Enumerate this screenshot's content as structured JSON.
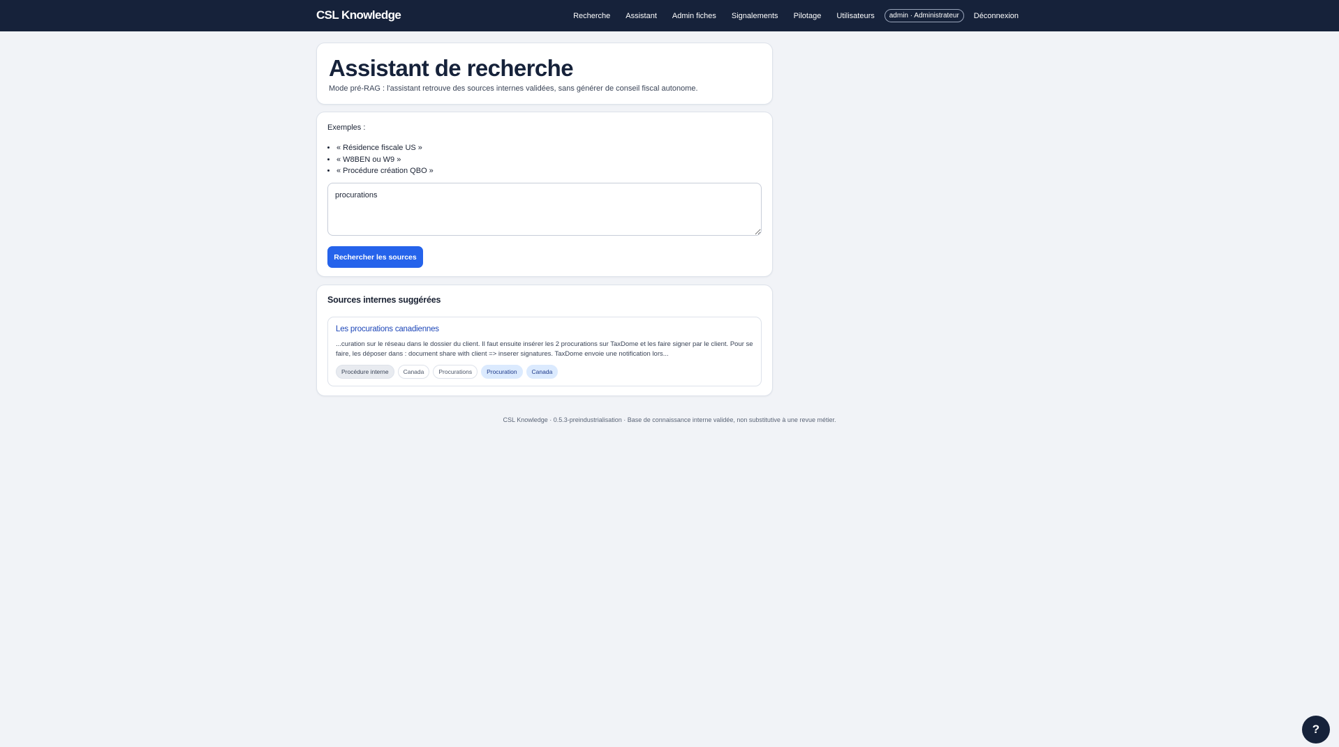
{
  "header": {
    "brand": "CSL Knowledge",
    "nav": [
      {
        "label": "Recherche"
      },
      {
        "label": "Assistant"
      },
      {
        "label": "Admin fiches"
      },
      {
        "label": "Signalements"
      },
      {
        "label": "Pilotage"
      },
      {
        "label": "Utilisateurs"
      }
    ],
    "user_badge": "admin · Administrateur",
    "logout_label": "Déconnexion"
  },
  "page": {
    "title": "Assistant de recherche",
    "subtitle": "Mode pré-RAG : l'assistant retrouve des sources internes validées, sans générer de conseil fiscal autonome."
  },
  "search": {
    "examples_label": "Exemples :",
    "examples": [
      "« Résidence fiscale US »",
      "« W8BEN ou W9 »",
      "« Procédure création QBO »"
    ],
    "query_value": "procurations",
    "submit_label": "Rechercher les sources"
  },
  "results": {
    "title": "Sources internes suggérées",
    "items": [
      {
        "title": "Les procurations canadiennes",
        "snippet": "...curation sur le réseau dans le dossier du client. Il faut ensuite insérer les 2 procurations sur TaxDome et les faire signer par le client. Pour se faire, les déposer dans : document share with client => inserer signatures. TaxDome envoie une notification lors...",
        "tags": [
          "Procédure interne",
          "Canada",
          "Procurations",
          "Procuration",
          "Canada"
        ]
      }
    ]
  },
  "footer": {
    "text": "CSL Knowledge · 0.5.3-preindustrialisation · Base de connaissance interne validée, non substitutive à une revue métier."
  },
  "help_button": {
    "label": "?"
  },
  "colors": {
    "topbar": "#16223a",
    "accent": "#2563eb",
    "link": "#1d46b8",
    "background": "#f1f3f7"
  }
}
